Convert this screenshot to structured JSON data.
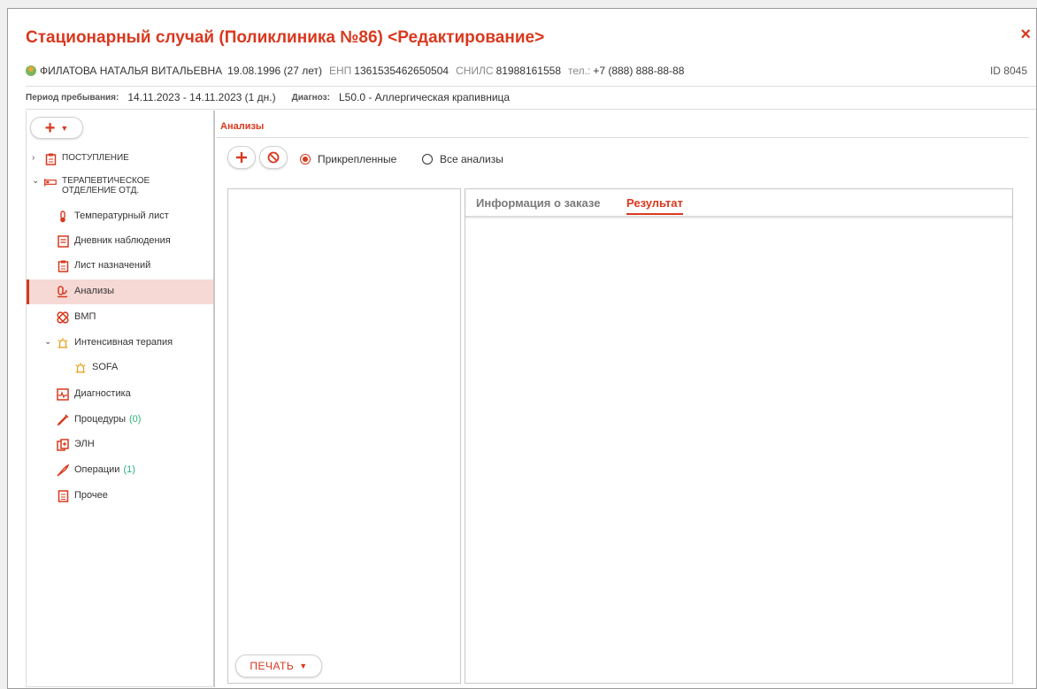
{
  "window": {
    "title": "Стационарный случай (Поликлиника №86) <Редактирование>",
    "close_label": "×"
  },
  "patient": {
    "name": "ФИЛАТОВА НАТАЛЬЯ ВИТАЛЬЕВНА",
    "birth": "19.08.1996 (27 лет)",
    "enp_label": "ЕНП",
    "enp": "1361535462650504",
    "snils_label": "СНИЛС",
    "snils": "81988161558",
    "phone_label": "тел.:",
    "phone": "+7 (888) 888-88-88",
    "id": "ID 8045"
  },
  "stay": {
    "period_label": "Период пребывания:",
    "period": "14.11.2023 - 14.11.2023 (1 дн.)",
    "diagnosis_label": "Диагноз:",
    "diagnosis": "L50.0 - Аллергическая крапивница"
  },
  "sidebar": {
    "add_label": "+",
    "items": [
      {
        "label": "ПОСТУПЛЕНИЕ",
        "icon": "clipboard-icon"
      },
      {
        "label": "ТЕРАПЕВТИЧЕСКОЕ",
        "label2": "ОТДЕЛЕНИЕ ОТД.",
        "icon": "bed-icon"
      },
      {
        "label": "Температурный лист",
        "icon": "thermometer-icon"
      },
      {
        "label": "Дневник наблюдения",
        "icon": "notebook-icon"
      },
      {
        "label": "Лист назначений",
        "icon": "clipboard-list-icon"
      },
      {
        "label": "Анализы",
        "icon": "lab-icon"
      },
      {
        "label": "ВМП",
        "icon": "bandage-icon"
      },
      {
        "label": "Интенсивная терапия",
        "icon": "alarm-icon"
      },
      {
        "label": "SOFA",
        "icon": "alarm-icon"
      },
      {
        "label": "Диагностика",
        "icon": "ecg-icon"
      },
      {
        "label": "Процедуры",
        "count": "(0)",
        "icon": "syringe-icon"
      },
      {
        "label": "ЭЛН",
        "icon": "document-copy-icon"
      },
      {
        "label": "Операции",
        "count": "(1)",
        "icon": "scalpel-icon"
      },
      {
        "label": "Прочее",
        "icon": "file-icon"
      }
    ]
  },
  "main": {
    "section_title": "Анализы",
    "radio_attached": "Прикрепленные",
    "radio_all": "Все анализы",
    "tabs": [
      "Информация о заказе",
      "Результат"
    ],
    "active_tab": "Результат",
    "print_label": "ПЕЧАТЬ"
  },
  "colors": {
    "accent": "#d9381e",
    "count": "#2bb07f",
    "active_bg": "#f6d9d5"
  }
}
